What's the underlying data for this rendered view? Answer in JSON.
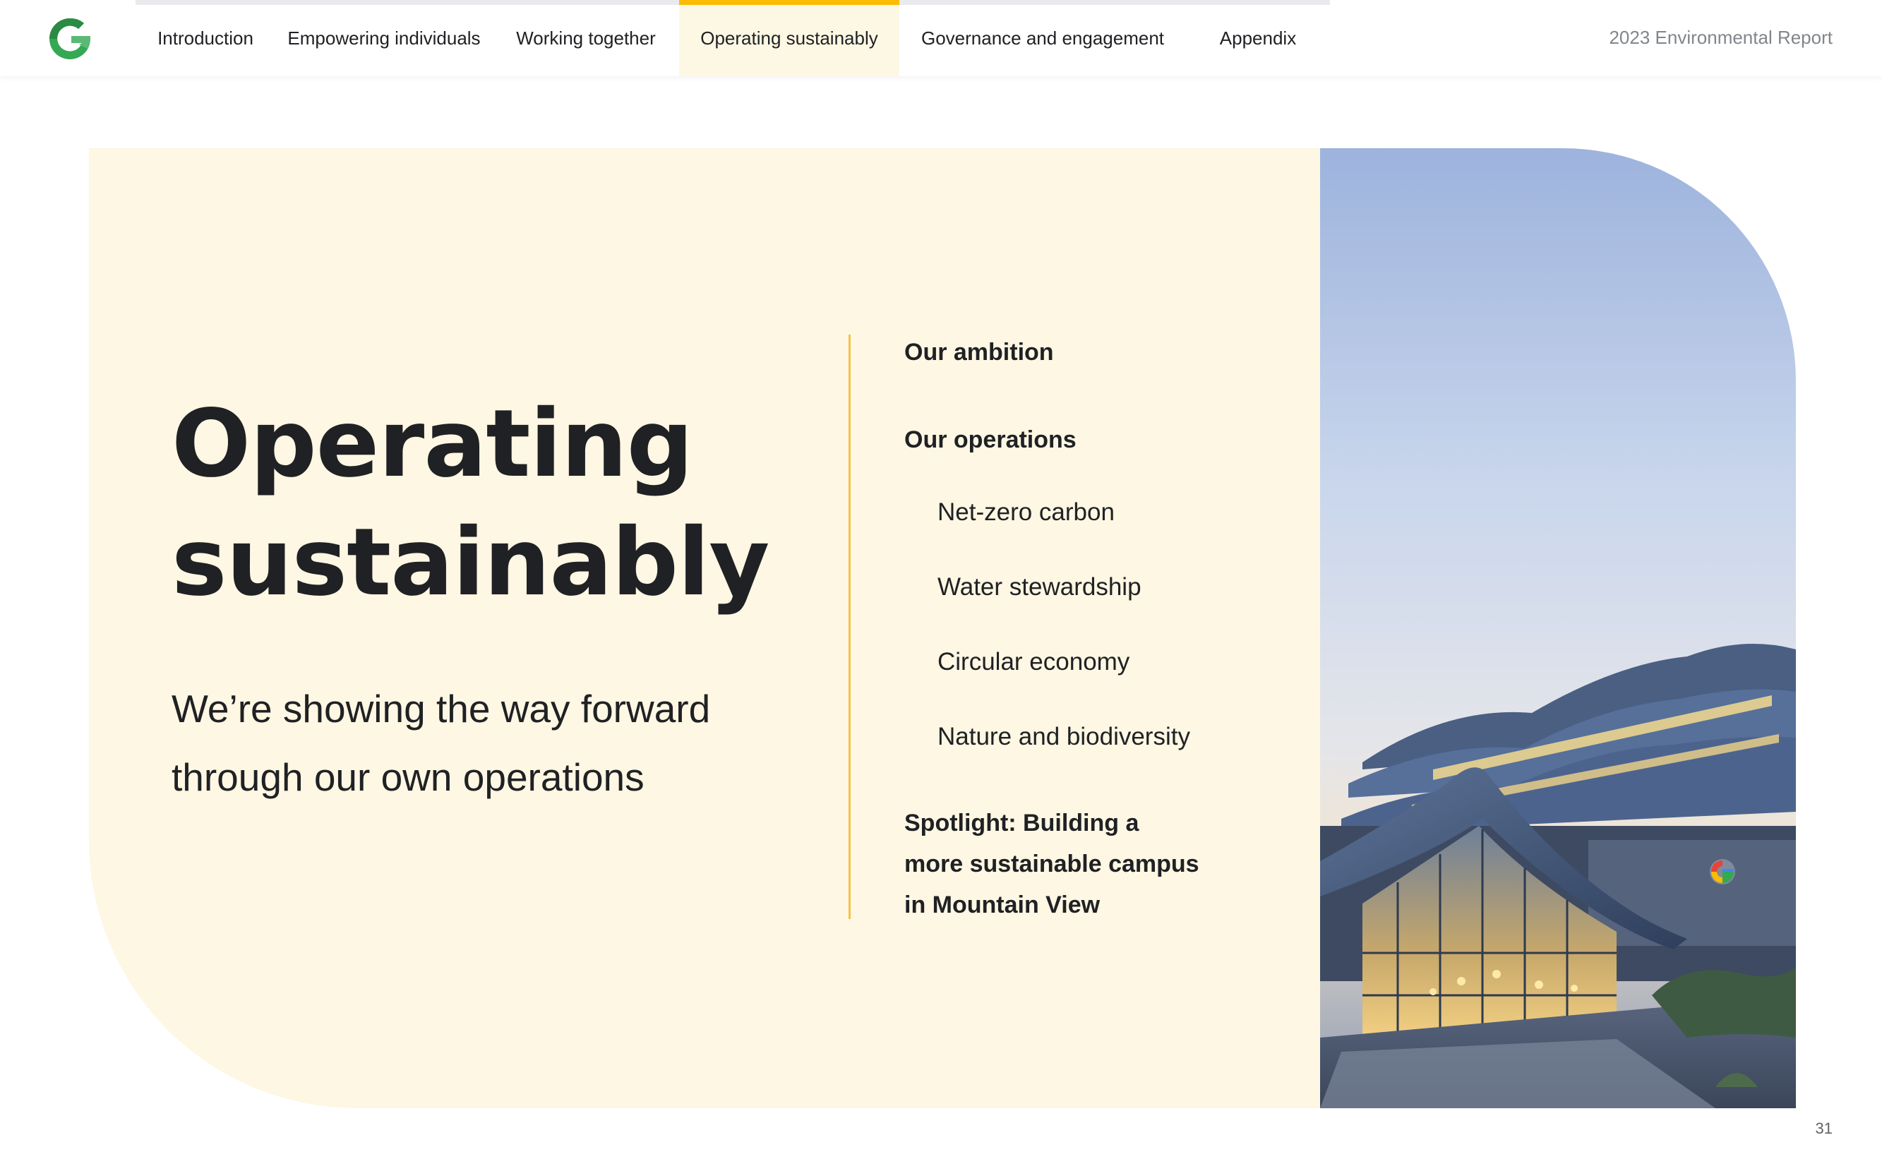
{
  "header": {
    "nav": [
      {
        "label": "Introduction",
        "active": false
      },
      {
        "label": "Empowering individuals",
        "active": false
      },
      {
        "label": "Working together",
        "active": false
      },
      {
        "label": "Operating sustainably",
        "active": true
      },
      {
        "label": "Governance and engagement",
        "active": false
      },
      {
        "label": "Appendix",
        "active": false
      }
    ],
    "report_title": "2023 Environmental Report",
    "logo_icon": "google-g-leaf-logo"
  },
  "main": {
    "title_line1": "Operating",
    "title_line2": "sustainably",
    "subtitle_line1": "We’re showing the way forward",
    "subtitle_line2": "through our own operations"
  },
  "toc": {
    "ambition": "Our ambition",
    "operations": "Our operations",
    "sub_items": [
      "Net-zero carbon",
      "Water stewardship",
      "Circular economy",
      "Nature and biodiversity"
    ],
    "spotlight_line1": "Spotlight: Building a",
    "spotlight_line2": "more sustainable campus",
    "spotlight_line3": "in Mountain View"
  },
  "footer": {
    "page_number": "31"
  },
  "colors": {
    "accent": "#fbbc04",
    "panel_bg": "#fdf7e3",
    "text": "#202124"
  }
}
